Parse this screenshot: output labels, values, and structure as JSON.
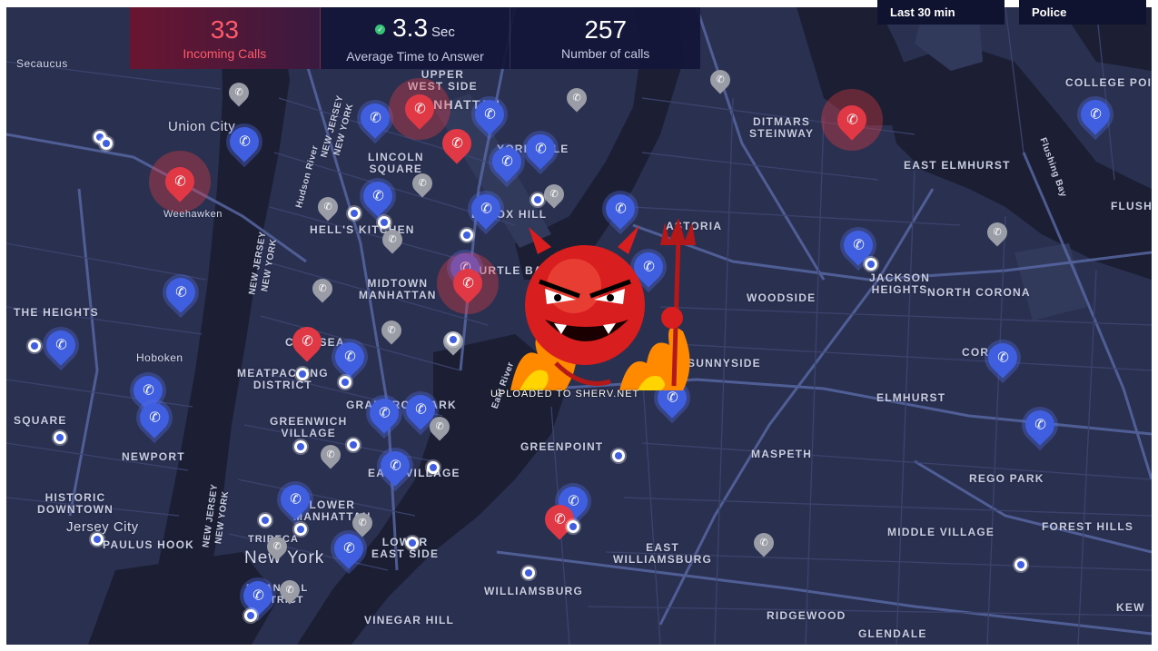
{
  "stats": {
    "incoming": {
      "value": "33",
      "label": "Incoming Calls"
    },
    "avg_answer": {
      "value": "3.3",
      "unit": "Sec",
      "label": "Average Time to Answer"
    },
    "num_calls": {
      "value": "257",
      "label": "Number of calls"
    }
  },
  "filters": {
    "time_range": "Last 30 min",
    "agency": "Police"
  },
  "watermark": "UPLOADED TO SHERV.NET",
  "colors": {
    "map_bg": "#2a3050",
    "water": "#1c1f33",
    "accent_blue": "#3f5fe0",
    "alert_red": "#e03845",
    "panel": "#121638"
  },
  "labels": {
    "secaucus": "Secaucus",
    "union_city": "Union City",
    "weehawken": "Weehawken",
    "the_heights": "THE HEIGHTS",
    "hoboken": "Hoboken",
    "square": "SQUARE",
    "newport": "NEWPORT",
    "historic_downtown": "HISTORIC\nDOWNTOWN",
    "jersey_city": "Jersey City",
    "paulus_hook": "PAULUS HOOK",
    "upper_west_side": "UPPER\nWEST SIDE",
    "manhattan": "MANHATTAN",
    "lincoln_square": "LINCOLN\nSQUARE",
    "yorkville": "YORKVILLE",
    "lenox_hill": "LENOX HILL",
    "hells_kitchen": "HELL'S KITCHEN",
    "midtown": "MIDTOWN\nMANHATTAN",
    "turtle_bay": "TURTLE BAY",
    "chelsea": "CHELSEA",
    "meatpacking": "MEATPACKING\nDISTRICT",
    "gramercy": "GRAMERCY PARK",
    "greenwich": "GREENWICH\nVILLAGE",
    "east_village": "EAST VILLAGE",
    "lower_manhattan": "LOWER\nMANHATTAN",
    "tribeca": "TRIBECA",
    "lower_east_side": "LOWER\nEAST SIDE",
    "new_york": "New York",
    "financial": "FINANCIAL\nDISTRICT",
    "vinegar_hill": "VINEGAR HILL",
    "astoria": "ASTORIA",
    "ditmars": "DITMARS\nSTEINWAY",
    "east_elmhurst": "EAST ELMHURST",
    "college_point": "COLLEGE POINT",
    "flushing": "FLUSHING",
    "jackson_heights": "JACKSON\nHEIGHTS",
    "north_corona": "NORTH CORONA",
    "woodside": "WOODSIDE",
    "sunnyside": "SUNNYSIDE",
    "corona": "CORONA",
    "elmhurst": "ELMHURST",
    "maspeth": "MASPETH",
    "greenpoint": "GREENPOINT",
    "rego_park": "REGO PARK",
    "middle_village": "MIDDLE VILLAGE",
    "forest_hills": "FOREST HILLS",
    "east_williamsburg": "EAST\nWILLIAMSBURG",
    "williamsburg": "WILLIAMSBURG",
    "ridgewood": "RIDGEWOOD",
    "glendale": "GLENDALE",
    "kew": "KEW",
    "hudson_river": "Hudson River",
    "east_river": "East River",
    "flushing_bay": "Flushing Bay",
    "nj_ny_1": "NEW JERSEY\nNEW YORK",
    "nj_ny_2": "NEW JERSEY\nNEW YORK",
    "nj_ny_3": "NEW JERSEY\nNEW YORK"
  },
  "markers": {
    "call_icon": "phone-icon",
    "location_icon": "location-dot-icon"
  }
}
